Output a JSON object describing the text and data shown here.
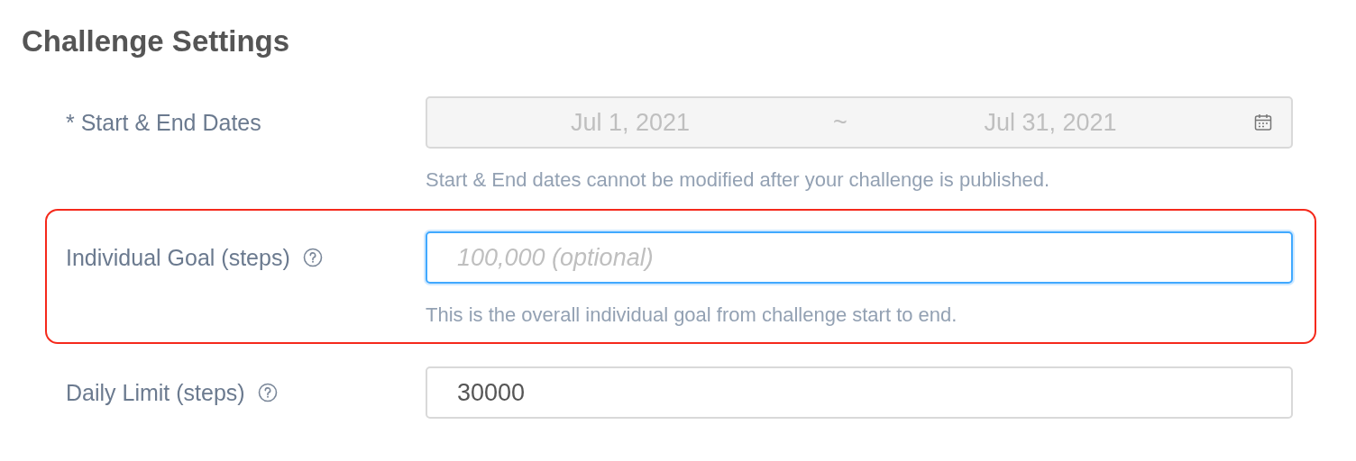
{
  "title": "Challenge Settings",
  "fields": [
    {
      "kind": "date_range",
      "label": "* Start & End Dates",
      "info": false,
      "start": "Jul 1, 2021",
      "separator": "~",
      "end": "Jul 31, 2021",
      "disabled": true,
      "highlighted": false,
      "help": "Start & End dates cannot be modified after your challenge is published."
    },
    {
      "kind": "text",
      "label": "Individual Goal (steps)",
      "info": true,
      "placeholder": "100,000 (optional)",
      "focused": true,
      "highlighted": true,
      "help": "This is the overall individual goal from challenge start to end."
    },
    {
      "kind": "text",
      "label": "Daily Limit (steps)",
      "info": true,
      "value": "30000",
      "focused": false,
      "highlighted": false
    }
  ]
}
